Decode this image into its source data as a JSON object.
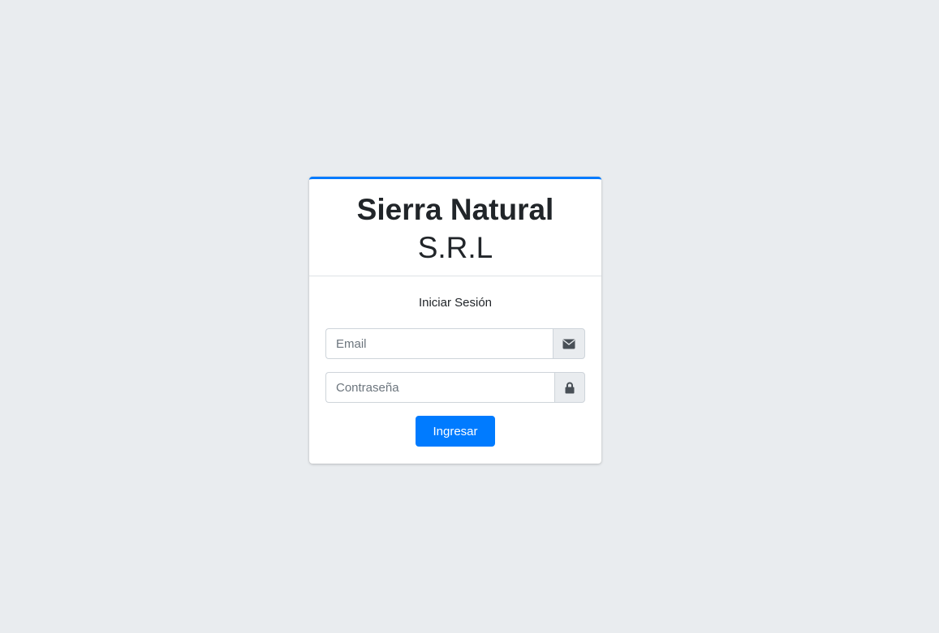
{
  "brand": {
    "name_bold": "Sierra Natural",
    "name_light": "S.R.L"
  },
  "login": {
    "message": "Iniciar Sesión",
    "email_placeholder": "Email",
    "email_value": "",
    "email_icon": "envelope-icon",
    "password_placeholder": "Contraseña",
    "password_value": "",
    "password_icon": "lock-icon",
    "submit_label": "Ingresar"
  },
  "colors": {
    "background": "#e9ecef",
    "accent": "#007bff",
    "card": "#ffffff",
    "icon": "#495057"
  }
}
